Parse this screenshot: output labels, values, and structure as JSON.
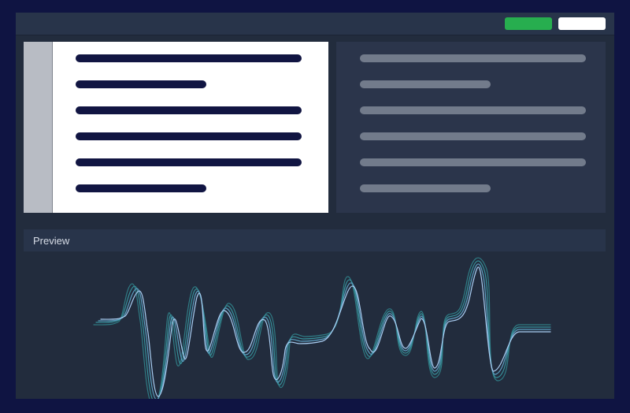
{
  "preview": {
    "title": "Preview"
  },
  "colors": {
    "outer_background": "#0f1442",
    "window_background": "#222c3d",
    "toolbar_background": "#28344a",
    "primary_button": "#27ae4f",
    "secondary_button": "#ffffff",
    "source_text_line": "#111542",
    "translation_text_line": "#727b8b",
    "waveform_outer": "#2f7b84",
    "waveform_inner": "#a9cdf2"
  },
  "icons": {
    "waveform": "audio-waveform-icon"
  }
}
